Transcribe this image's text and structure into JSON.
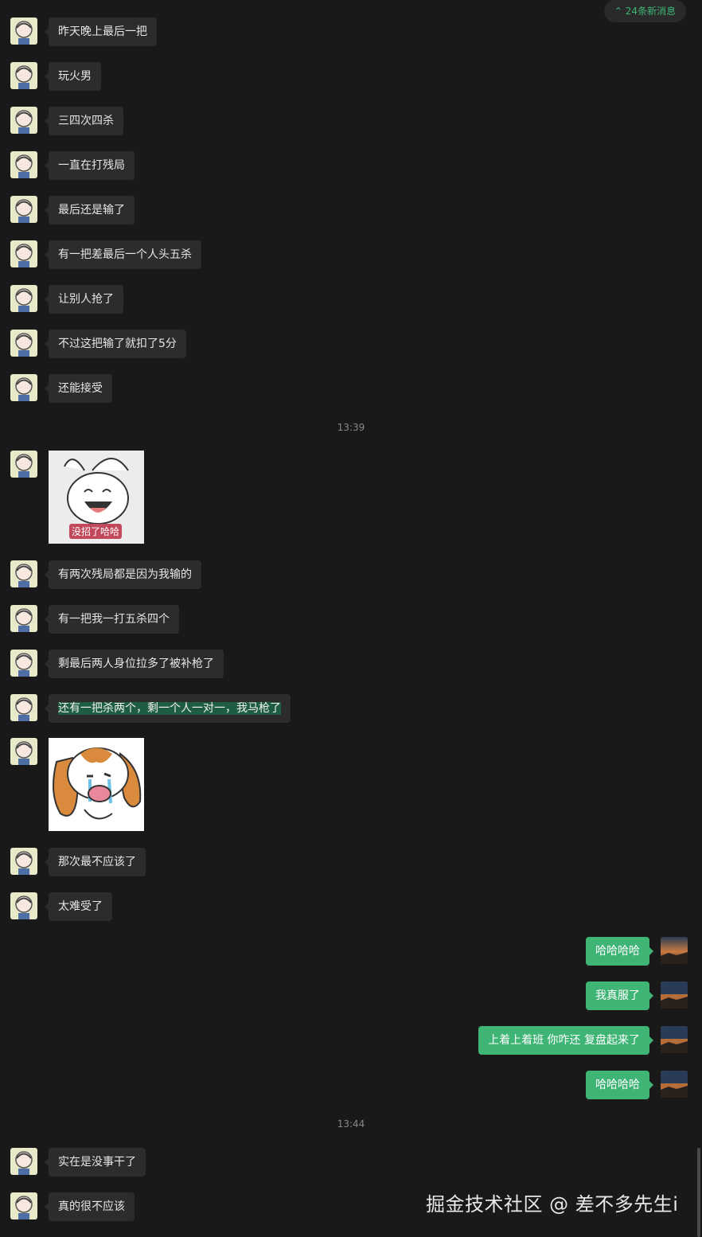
{
  "new_messages_badge": {
    "icon": "double-chevron-up-icon",
    "label": "24条新消息"
  },
  "timestamps": [
    "13:39",
    "13:44"
  ],
  "messages": [
    {
      "text": "昨天晚上最后一把"
    },
    {
      "text": "玩火男"
    },
    {
      "text": "三四次四杀"
    },
    {
      "text": "一直在打残局"
    },
    {
      "text": "最后还是输了"
    },
    {
      "text": "有一把差最后一个人头五杀"
    },
    {
      "text": "让别人抢了"
    },
    {
      "text": "不过这把输了就扣了5分"
    },
    {
      "text": "还能接受"
    },
    {
      "sticker": "laughing-rabbit-sticker",
      "caption": "没招了哈哈"
    },
    {
      "text": "有两次残局都是因为我输的"
    },
    {
      "text": "有一把我一打五杀四个"
    },
    {
      "text": "剩最后两人身位拉多了被补枪了"
    },
    {
      "text": "还有一把杀两个，剩一个人一对一，我马枪了"
    },
    {
      "sticker": "crying-dog-sticker"
    },
    {
      "text": "那次最不应该了"
    },
    {
      "text": "太难受了"
    },
    {
      "text": "哈哈哈哈"
    },
    {
      "text": "我真服了"
    },
    {
      "text": "上着上着班  你咋还  复盘起来了"
    },
    {
      "text": "哈哈哈哈"
    },
    {
      "text": "实在是没事干了"
    },
    {
      "text": "真的很不应该"
    }
  ],
  "watermark": "掘金技术社区 @ 差不多先生i",
  "colors": {
    "background": "#191919",
    "incoming_bubble": "#2c2c2c",
    "outgoing_bubble": "#3eb575",
    "accent": "#3eb575"
  }
}
